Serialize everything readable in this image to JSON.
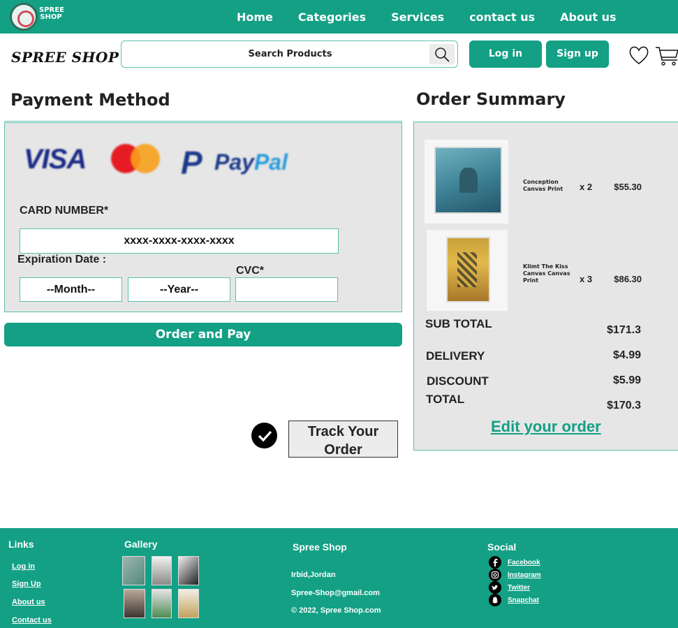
{
  "topnav": {
    "logo_text": "SPREE SHOP",
    "links": [
      "Home",
      "Categories",
      "Services",
      "contact us",
      "About us"
    ]
  },
  "header": {
    "brand": "SPREE SHOP",
    "search_label": "Search Products",
    "login": "Log in",
    "signup": "Sign up"
  },
  "payment": {
    "title": "Payment Method",
    "card_logos": {
      "visa": "VISA",
      "mastercard": "MasterCard",
      "paypal_a": "Pay",
      "paypal_b": "Pal"
    },
    "card_number_label": "CARD NUMBER*",
    "card_number_value": "xxxx-xxxx-xxxx-xxxx",
    "expiration_label": "Expiration Date :",
    "month_value": "--Month--",
    "year_value": "--Year--",
    "cvc_label": "CVC*",
    "cvc_value": "",
    "order_pay": "Order and Pay"
  },
  "track": {
    "label": "Track Your Order"
  },
  "summary": {
    "title": "Order Summary",
    "items": [
      {
        "name": "Conception Canvas Print",
        "qty": "x 2",
        "price": "$55.30"
      },
      {
        "name": "Klimt The Kiss Canvas Canvas Print",
        "qty": "x 3",
        "price": "$86.30"
      }
    ],
    "subtotal_label": "SUB TOTAL",
    "subtotal_value": "$171.3",
    "delivery_label": "DELIVERY",
    "delivery_value": "$4.99",
    "discount_label": "DISCOUNT",
    "discount_value": "$5.99",
    "total_label": "TOTAL",
    "total_value": "$170.3",
    "edit_link": "Edit your order"
  },
  "footer": {
    "links_head": "Links",
    "links": [
      "Log in",
      "Sign Up",
      "About us",
      "Contact us"
    ],
    "gallery_head": "Gallery",
    "spree_head": "Spree Shop",
    "info": [
      "Irbid,Jordan",
      "Spree-Shop@gmail.com",
      "© 2022, Spree Shop.com"
    ],
    "social_head": "Social",
    "social": [
      "Facebook",
      "Instagram",
      "Twitter",
      "Snapchat"
    ]
  },
  "colors": {
    "accent": "#13a085",
    "panel": "#e6e6e6",
    "border": "#5cc0ad"
  },
  "icons": [
    "logo-icon",
    "search-icon",
    "heart-icon",
    "cart-icon",
    "check-icon",
    "facebook-icon",
    "instagram-icon",
    "twitter-icon",
    "snapchat-icon"
  ]
}
